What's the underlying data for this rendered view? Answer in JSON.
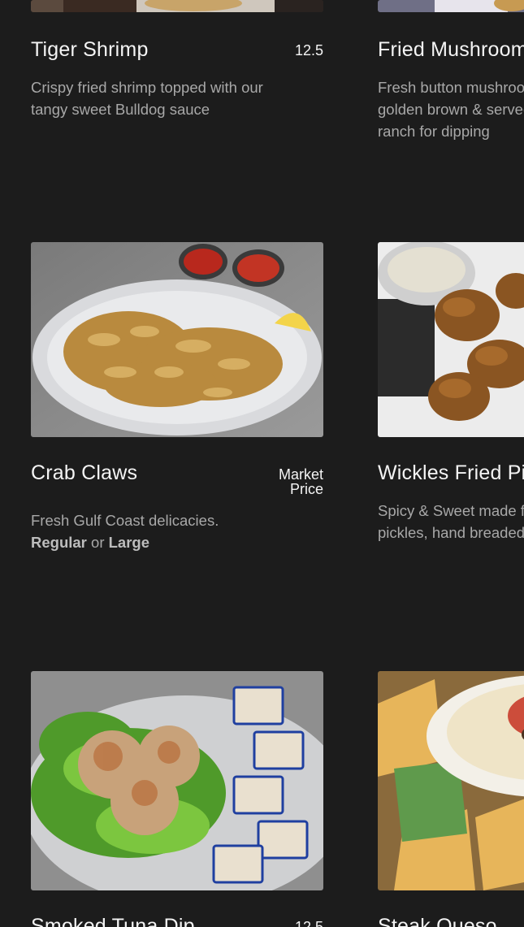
{
  "menu": {
    "items": [
      {
        "title": "Tiger Shrimp",
        "price": "12.5",
        "description": "Crispy fried shrimp topped with our tangy sweet Bulldog sauce"
      },
      {
        "title": "Fried Mushrooms",
        "price": "",
        "description": "Fresh button mushrooms fried golden brown & served with ranch for dipping"
      },
      {
        "title": "Crab Claws",
        "price_line1": "Market",
        "price_line2": "Price",
        "description": "Fresh Gulf Coast delicacies.",
        "option_regular": "Regular",
        "option_or": "or",
        "option_large": "Large"
      },
      {
        "title": "Wickles Fried Pickles",
        "price": "",
        "description": "Spicy & Sweet made from Wickles pickles, hand breaded"
      },
      {
        "title": "Smoked Tuna Dip",
        "price": "12.5"
      },
      {
        "title": "Steak Queso",
        "price": ""
      }
    ]
  }
}
